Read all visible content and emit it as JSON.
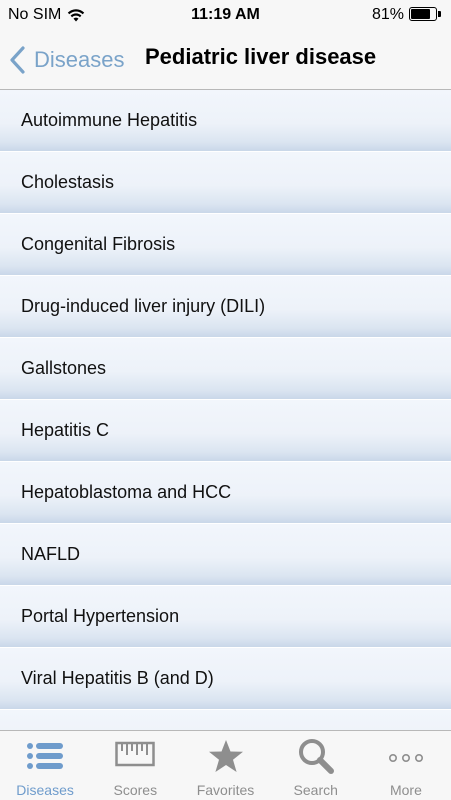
{
  "status_bar": {
    "carrier": "No SIM",
    "time": "11:19 AM",
    "battery_percent_label": "81%",
    "battery_level": 0.81
  },
  "nav": {
    "back_label": "Diseases",
    "title": "Pediatric liver disease"
  },
  "list": {
    "items": [
      "Autoimmune Hepatitis",
      "Cholestasis",
      "Congenital Fibrosis",
      "Drug-induced liver injury (DILI)",
      "Gallstones",
      "Hepatitis C",
      "Hepatoblastoma and HCC",
      "NAFLD",
      "Portal Hypertension",
      "Viral Hepatitis B (and D)"
    ]
  },
  "tab_bar": {
    "tabs": [
      {
        "label": "Diseases",
        "icon": "list-icon",
        "active": true
      },
      {
        "label": "Scores",
        "icon": "ruler-icon",
        "active": false
      },
      {
        "label": "Favorites",
        "icon": "star-icon",
        "active": false
      },
      {
        "label": "Search",
        "icon": "search-icon",
        "active": false
      },
      {
        "label": "More",
        "icon": "more-icon",
        "active": false
      }
    ]
  },
  "colors": {
    "accent": "#6f9ccc",
    "back_link": "#7aa3c9",
    "inactive_tab": "#8e8e8e"
  }
}
